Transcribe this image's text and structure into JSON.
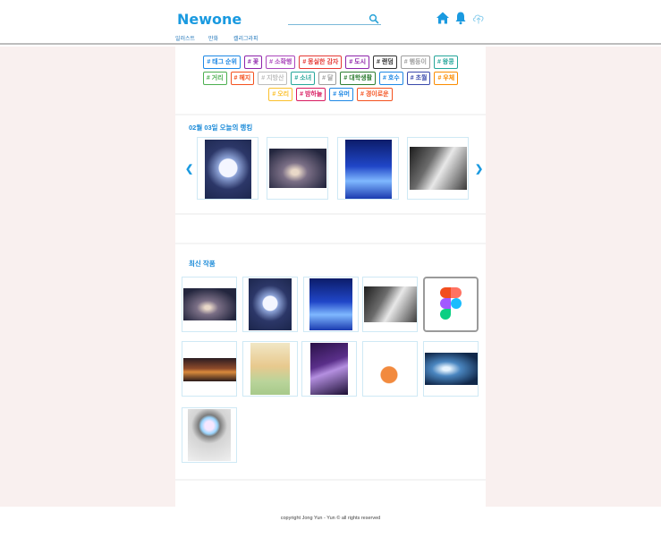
{
  "header": {
    "logo": "Newone",
    "nav": [
      "일러스트",
      "만화",
      "캘리그라피"
    ],
    "search": {
      "placeholder": "",
      "value": ""
    },
    "icons": [
      "search-icon",
      "home-icon",
      "bell-icon",
      "upload-icon"
    ]
  },
  "tags": [
    {
      "label": "# 태그 순위",
      "color": "#1e88e5"
    },
    {
      "label": "# 꽃",
      "color": "#8e24aa"
    },
    {
      "label": "# 소확행",
      "color": "#ab47bc"
    },
    {
      "label": "# 몽실한 감자",
      "color": "#e53935"
    },
    {
      "label": "# 도시",
      "color": "#8e24aa"
    },
    {
      "label": "# 랜덤",
      "color": "#333333"
    },
    {
      "label": "# 햄둥이",
      "color": "#9e9e9e"
    },
    {
      "label": "# 왕콩",
      "color": "#26a69a"
    },
    {
      "label": "# 거리",
      "color": "#4caf50"
    },
    {
      "label": "# 헤지",
      "color": "#f4511e"
    },
    {
      "label": "# 지방산",
      "color": "#bdbdbd"
    },
    {
      "label": "# 소녀",
      "color": "#26a69a"
    },
    {
      "label": "# 달",
      "color": "#9e9e9e"
    },
    {
      "label": "# 대학생활",
      "color": "#2e7d32"
    },
    {
      "label": "# 호수",
      "color": "#1e88e5"
    },
    {
      "label": "# 초월",
      "color": "#3949ab"
    },
    {
      "label": "# 우체",
      "color": "#fb8c00"
    },
    {
      "label": "# 오리",
      "color": "#fbc02d"
    },
    {
      "label": "# 밤하늘",
      "color": "#d81b60"
    },
    {
      "label": "# 유머",
      "color": "#1e88e5"
    },
    {
      "label": "# 경이로운",
      "color": "#f4511e"
    }
  ],
  "ranking": {
    "title": "02월 03일 오늘의 랭킹",
    "prev_icon": "chevron-left-icon",
    "next_icon": "chevron-right-icon"
  },
  "latest": {
    "title": "최신 작품"
  },
  "footer": {
    "text": "copyright Jong Yun - Yun © all rights reserved"
  },
  "colors": {
    "accent": "#1a9ae0",
    "side_background": "#f9f0ef"
  }
}
